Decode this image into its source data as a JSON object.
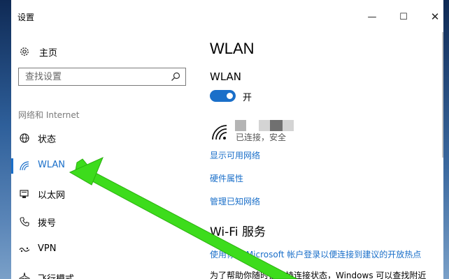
{
  "window": {
    "title": "设置",
    "controls": {
      "minimize": "—",
      "maximize": "☐",
      "close": "✕"
    }
  },
  "sidebar": {
    "home": "主页",
    "search": {
      "placeholder": "查找设置",
      "value": ""
    },
    "section_label": "网络和 Internet",
    "items": [
      {
        "label": "状态",
        "icon": "globe-icon",
        "active": false
      },
      {
        "label": "WLAN",
        "icon": "wifi-icon",
        "active": true
      },
      {
        "label": "以太网",
        "icon": "ethernet-icon",
        "active": false
      },
      {
        "label": "拨号",
        "icon": "phone-icon",
        "active": false
      },
      {
        "label": "VPN",
        "icon": "vpn-icon",
        "active": false
      },
      {
        "label": "飞行模式",
        "icon": "airplane-icon",
        "active": false
      }
    ]
  },
  "main": {
    "title": "WLAN",
    "wlan_label": "WLAN",
    "toggle": {
      "state": "开",
      "on": true
    },
    "network": {
      "status": "已连接，安全"
    },
    "links": [
      "显示可用网络",
      "硬件属性",
      "管理已知网络"
    ],
    "wifi_service_title": "Wi-Fi 服务",
    "wifi_service_link": "使用你的 Microsoft 帐户登录以便连接到建议的开放热点",
    "body_text": "为了帮助你随时都保持连接状态，Windows 可以查找附近"
  },
  "colors": {
    "accent": "#1a6fc9",
    "annotation_arrow": "#3ddc1c"
  }
}
